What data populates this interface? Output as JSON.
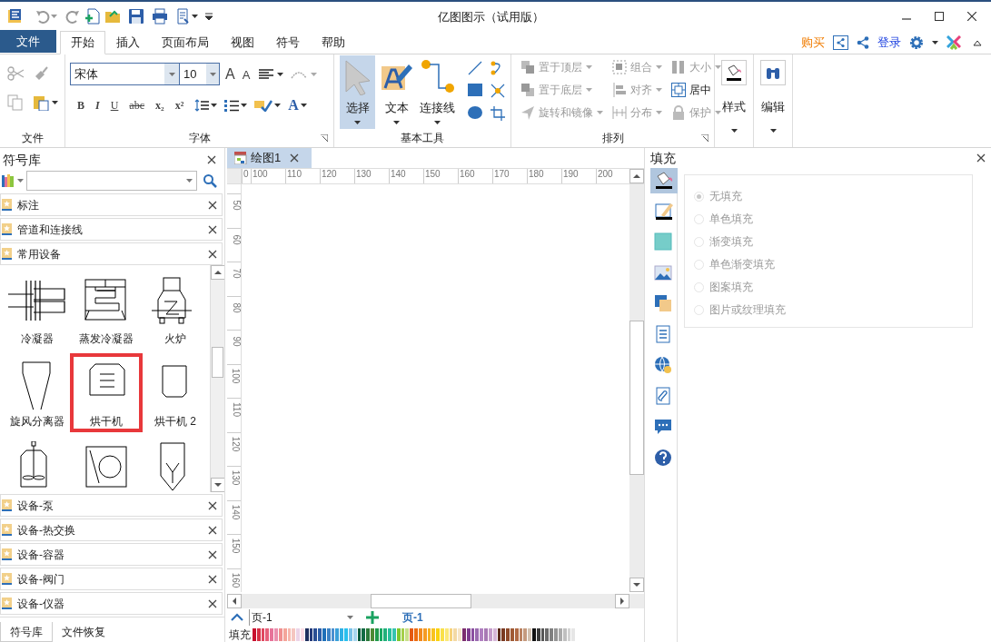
{
  "window": {
    "title": "亿图图示（试用版）"
  },
  "menu_tabs": [
    {
      "label": "文件",
      "kind": "file",
      "selected": false
    },
    {
      "label": "开始",
      "kind": "tab",
      "selected": true
    },
    {
      "label": "插入",
      "kind": "tab",
      "selected": false
    },
    {
      "label": "页面布局",
      "kind": "tab",
      "selected": false
    },
    {
      "label": "视图",
      "kind": "tab",
      "selected": false
    },
    {
      "label": "符号",
      "kind": "tab",
      "selected": false
    },
    {
      "label": "帮助",
      "kind": "tab",
      "selected": false
    }
  ],
  "account": {
    "buy": "购买",
    "login": "登录"
  },
  "ribbon": {
    "file_group": {
      "label": "文件"
    },
    "font_group": {
      "label": "字体",
      "font": "宋体",
      "size": "10",
      "grow": "A",
      "shrink": "A",
      "styles": [
        "B",
        "I",
        "U",
        "abc",
        "x₂",
        "x²"
      ],
      "font_color": "A"
    },
    "basic_tools": {
      "label": "基本工具",
      "buttons": [
        {
          "label": "选择",
          "kind": "select",
          "selected": true
        },
        {
          "label": "文本",
          "kind": "text",
          "selected": false
        },
        {
          "label": "连接线",
          "kind": "connector",
          "selected": false
        }
      ]
    },
    "arrange": {
      "label": "排列",
      "items": [
        {
          "label": "置于顶层",
          "kind": "front",
          "disabled": true
        },
        {
          "label": "组合",
          "kind": "group",
          "disabled": true
        },
        {
          "label": "大小",
          "kind": "size",
          "disabled": true
        },
        {
          "label": "置于底层",
          "kind": "back",
          "disabled": true
        },
        {
          "label": "对齐",
          "kind": "align",
          "disabled": true
        },
        {
          "label": "居中",
          "kind": "center",
          "disabled": false
        },
        {
          "label": "旋转和镜像",
          "kind": "rotate",
          "disabled": true
        },
        {
          "label": "分布",
          "kind": "distribute",
          "disabled": true
        },
        {
          "label": "保护",
          "kind": "protect",
          "disabled": true
        }
      ]
    },
    "style_button": "样式",
    "edit_button": "编辑"
  },
  "library": {
    "title": "符号库",
    "categories_top": [
      {
        "label": "标注"
      },
      {
        "label": "管道和连接线"
      }
    ],
    "open_category": {
      "label": "常用设备",
      "symbols": [
        {
          "kind": "condenser",
          "label": "冷凝器",
          "highlighted": false
        },
        {
          "kind": "evaporative-condenser",
          "label": "蒸发冷凝器",
          "highlighted": false
        },
        {
          "kind": "furnace",
          "label": "火炉",
          "highlighted": false
        },
        {
          "kind": "cyclone",
          "label": "旋风分离器",
          "highlighted": false
        },
        {
          "kind": "dryer",
          "label": "烘干机",
          "highlighted": true
        },
        {
          "kind": "dryer2",
          "label": "烘干机 2",
          "highlighted": false
        },
        {
          "kind": "mixer",
          "highlighted": false
        },
        {
          "kind": "mixer2",
          "highlighted": false
        },
        {
          "kind": "mixer3",
          "highlighted": false
        }
      ]
    },
    "categories_bottom": [
      {
        "label": "设备-泵"
      },
      {
        "label": "设备-热交换"
      },
      {
        "label": "设备-容器"
      },
      {
        "label": "设备-阀门"
      },
      {
        "label": "设备-仪器"
      }
    ],
    "tabs": [
      {
        "label": "符号库",
        "selected": true
      },
      {
        "label": "文件恢复",
        "selected": false
      }
    ]
  },
  "document": {
    "tab": "绘图1",
    "ruler_h": [
      "0",
      "100",
      "110",
      "120",
      "130",
      "140",
      "150",
      "160",
      "170",
      "180",
      "190",
      "200"
    ],
    "ruler_v": [
      "50",
      "60",
      "70",
      "80",
      "90",
      "100",
      "110",
      "120",
      "130",
      "140",
      "150",
      "160"
    ],
    "page_select": "页-1",
    "page_tab": "页-1",
    "palette_label": "填充",
    "palette": [
      {
        "color": "#c8102e"
      },
      {
        "color": "#d62f45"
      },
      {
        "color": "#e0475f"
      },
      {
        "color": "#e6607a"
      },
      {
        "color": "#e77399"
      },
      {
        "color": "#ea8fae"
      },
      {
        "color": "#f08f8f"
      },
      {
        "color": "#f4a59a"
      },
      {
        "color": "#f7b7ad"
      },
      {
        "color": "#f5c6c0"
      },
      {
        "color": "#ecd3e7"
      },
      {
        "color": "#fbdde6"
      },
      {
        "color": "#1f2f5e"
      },
      {
        "color": "#243a7a"
      },
      {
        "color": "#2a4e93"
      },
      {
        "color": "#2d5ea8"
      },
      {
        "color": "#1d6fb8"
      },
      {
        "color": "#3b82c4"
      },
      {
        "color": "#4a8fd0"
      },
      {
        "color": "#3aa0da"
      },
      {
        "color": "#2fb0e5"
      },
      {
        "color": "#29c0ee"
      },
      {
        "color": "#79c1e8"
      },
      {
        "color": "#a8d6ef"
      },
      {
        "color": "#0b5a3b"
      },
      {
        "color": "#136b45"
      },
      {
        "color": "#2b7a3a"
      },
      {
        "color": "#4d8a34"
      },
      {
        "color": "#1f9a4a"
      },
      {
        "color": "#18a862"
      },
      {
        "color": "#21b07a"
      },
      {
        "color": "#27bf9b"
      },
      {
        "color": "#35c3b0"
      },
      {
        "color": "#7ec82e"
      },
      {
        "color": "#a5cf4a"
      },
      {
        "color": "#c9df8a"
      },
      {
        "color": "#e55a14"
      },
      {
        "color": "#ec6d12"
      },
      {
        "color": "#f28a1e"
      },
      {
        "color": "#f59b23"
      },
      {
        "color": "#f7af1f"
      },
      {
        "color": "#f8c21e"
      },
      {
        "color": "#fad20d"
      },
      {
        "color": "#f9e04a"
      },
      {
        "color": "#fbe878"
      },
      {
        "color": "#f7d27a"
      },
      {
        "color": "#f3d9a5"
      },
      {
        "color": "#f6e5c8"
      },
      {
        "color": "#7b2d6e"
      },
      {
        "color": "#7e3b8e"
      },
      {
        "color": "#8a4ea0"
      },
      {
        "color": "#9b6bb0"
      },
      {
        "color": "#b07fc0"
      },
      {
        "color": "#a879b4"
      },
      {
        "color": "#c49ccb"
      },
      {
        "color": "#d6b6d8"
      },
      {
        "color": "#5a2a1b"
      },
      {
        "color": "#7a3a22"
      },
      {
        "color": "#8e4a2a"
      },
      {
        "color": "#a05a35"
      },
      {
        "color": "#b06a45"
      },
      {
        "color": "#b98160"
      },
      {
        "color": "#c49a7e"
      },
      {
        "color": "#d2c1b0"
      },
      {
        "color": "#111111"
      },
      {
        "color": "#3a3a3a"
      },
      {
        "color": "#555555"
      },
      {
        "color": "#6b6b6b"
      },
      {
        "color": "#808080"
      },
      {
        "color": "#959595"
      },
      {
        "color": "#aaaaaa"
      },
      {
        "color": "#bfbfbf"
      },
      {
        "color": "#d4d4d4"
      },
      {
        "color": "#e6e6e6"
      }
    ]
  },
  "fill_panel": {
    "title": "填充",
    "tools": [
      {
        "kind": "fill",
        "selected": true
      },
      {
        "kind": "line",
        "selected": false
      },
      {
        "kind": "shape",
        "selected": false
      },
      {
        "kind": "image",
        "selected": false
      },
      {
        "kind": "layers",
        "selected": false
      },
      {
        "kind": "list",
        "selected": false
      },
      {
        "kind": "globe",
        "selected": false
      },
      {
        "kind": "attach",
        "selected": false
      },
      {
        "kind": "comment",
        "selected": false
      },
      {
        "kind": "help",
        "selected": false
      }
    ],
    "options": [
      {
        "label": "无填充",
        "selected": true
      },
      {
        "label": "单色填充",
        "selected": false
      },
      {
        "label": "渐变填充",
        "selected": false
      },
      {
        "label": "单色渐变填充",
        "selected": false
      },
      {
        "label": "图案填充",
        "selected": false
      },
      {
        "label": "图片或纹理填充",
        "selected": false
      }
    ]
  }
}
